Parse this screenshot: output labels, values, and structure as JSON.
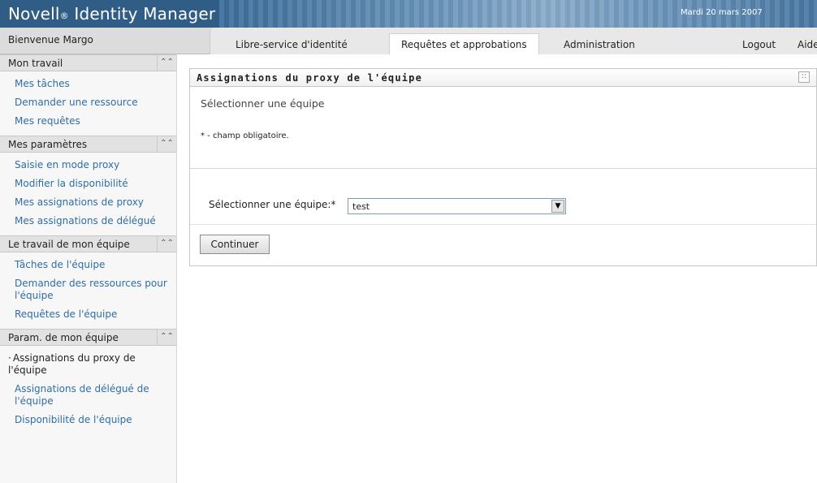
{
  "header": {
    "brand_name": "Novell",
    "brand_reg": "®",
    "brand_product": " Identity Manager",
    "date": "Mardi 20 mars 2007"
  },
  "nav": {
    "welcome": "Bienvenue Margo",
    "tabs": [
      {
        "label": "Libre-service d'identité"
      },
      {
        "label": "Requêtes et approbations",
        "active": true
      },
      {
        "label": "Administration"
      }
    ],
    "logout": "Logout",
    "help": "Aide"
  },
  "sidebar": {
    "sections": [
      {
        "title": "Mon travail",
        "items": [
          "Mes tâches",
          "Demander une ressource",
          "Mes requêtes"
        ]
      },
      {
        "title": "Mes paramètres",
        "items": [
          "Saisie en mode proxy",
          "Modifier la disponibilité",
          "Mes assignations de proxy",
          "Mes assignations de délégué"
        ]
      },
      {
        "title": "Le travail de mon équipe",
        "items": [
          "Tâches de l'équipe",
          "Demander des ressources pour l'équipe",
          "Requêtes de l'équipe"
        ]
      },
      {
        "title": "Param. de mon équipe",
        "items": [
          "Assignations du proxy de l'équipe",
          "Assignations de délégué de l'équipe",
          "Disponibilité de l'équipe"
        ]
      }
    ],
    "collapse_glyph": "≈"
  },
  "panel": {
    "title": "Assignations du proxy de l'équipe",
    "subtitle": "Sélectionner une équipe",
    "required_note": "* - champ obligatoire.",
    "field_label": "Sélectionner une équipe:*",
    "select_value": "test",
    "continue_label": "Continuer"
  },
  "colors": {
    "header_bg": "#2f5d86",
    "link": "#2e6ea6"
  },
  "icons": {
    "collapse": "double-chevron-up-icon",
    "panel_menu": "grid-menu-icon",
    "dropdown": "dropdown-arrow-icon"
  }
}
